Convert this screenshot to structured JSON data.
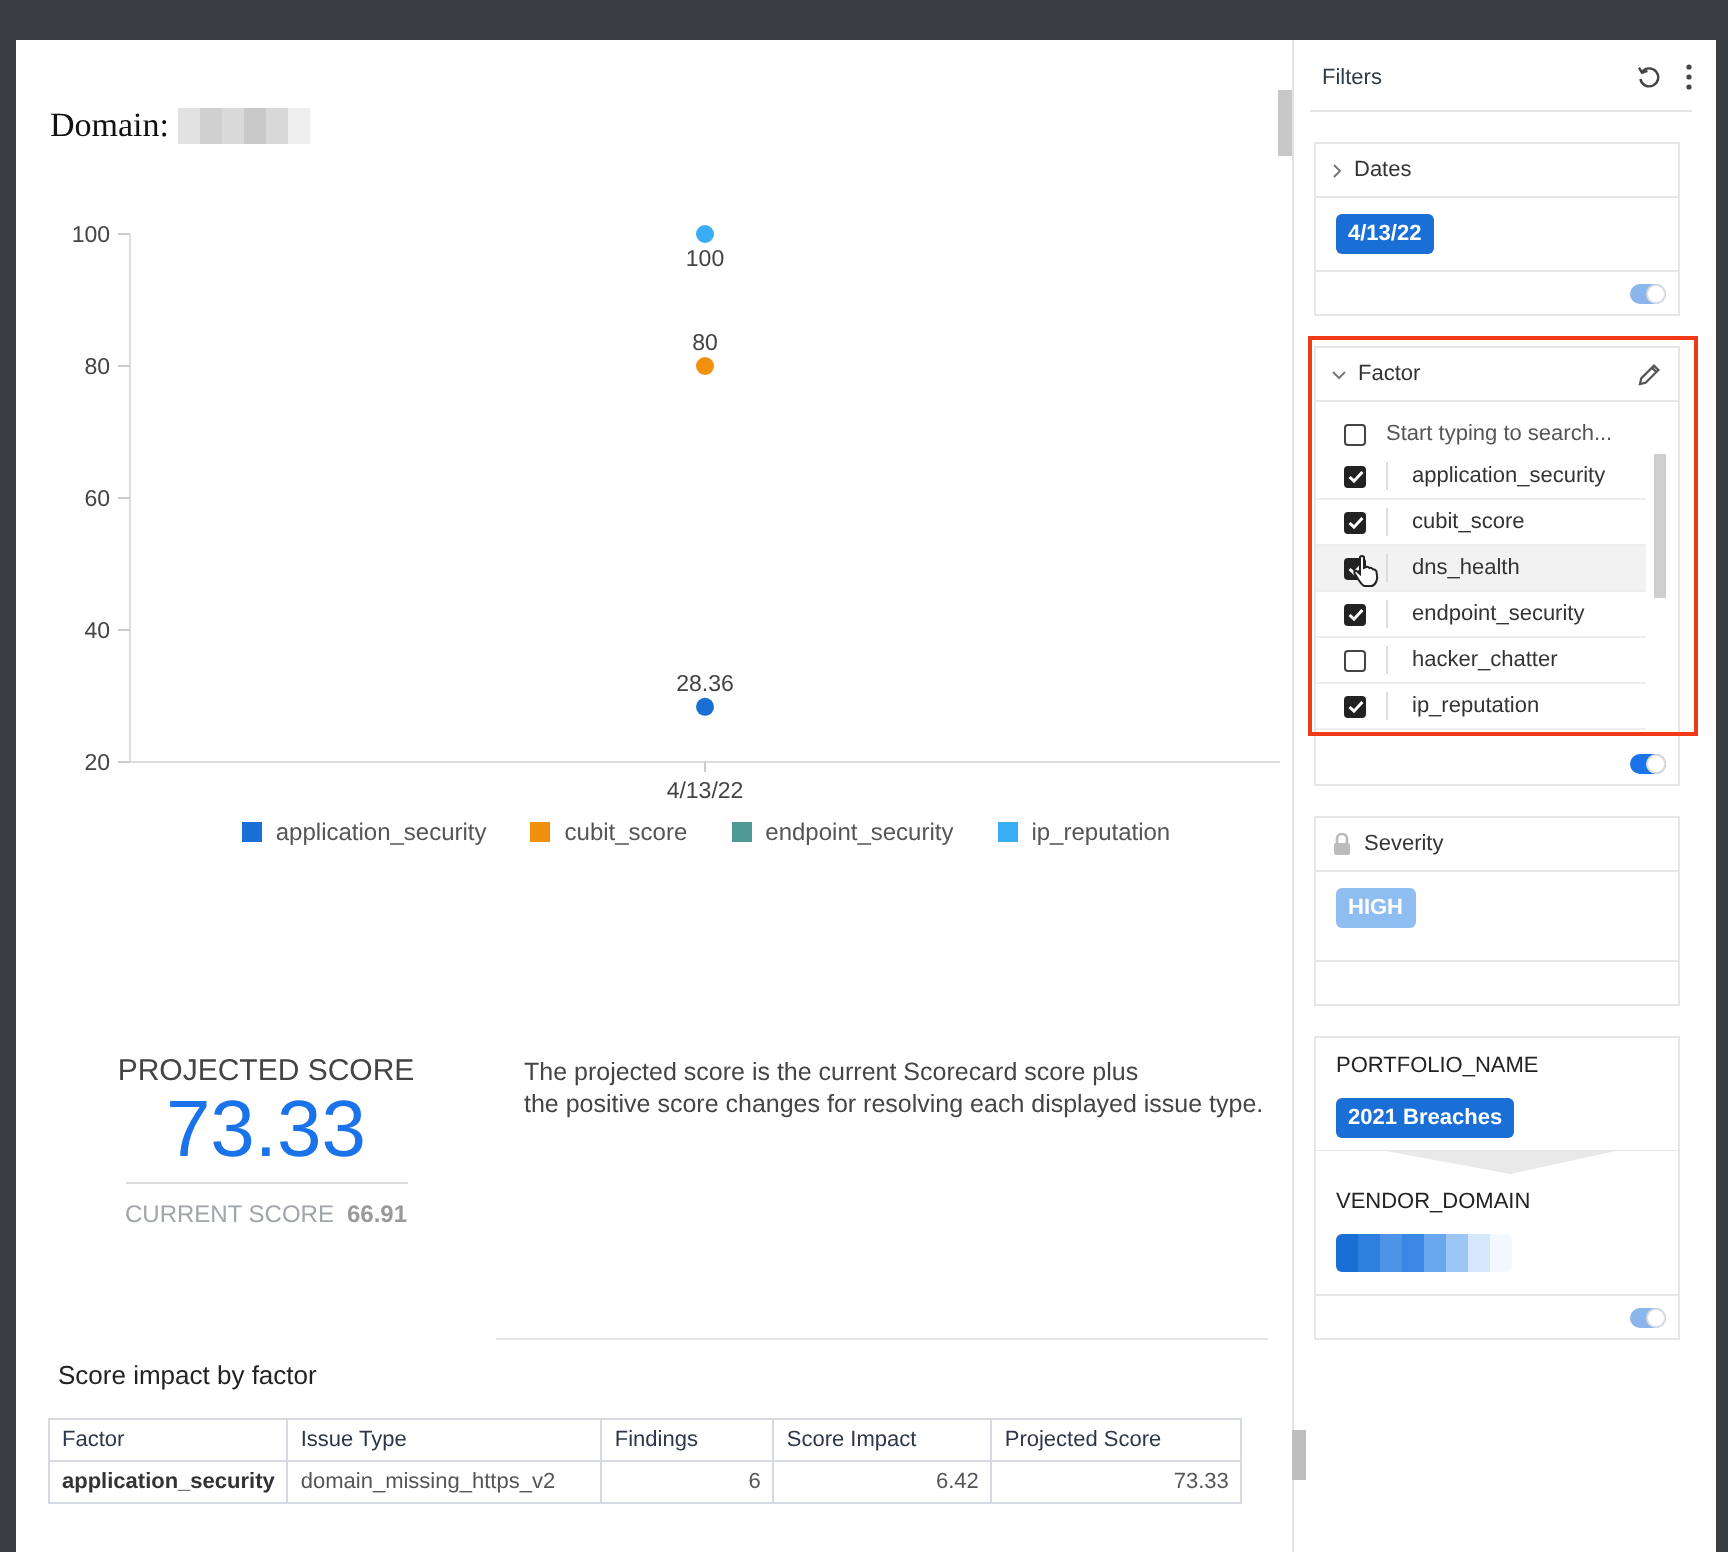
{
  "domain": {
    "label": "Domain:",
    "redacted": true
  },
  "chart": {
    "chart_data": {
      "type": "scatter",
      "categories": [
        "4/13/22"
      ],
      "ylim": [
        20,
        100
      ],
      "yticks": [
        20,
        40,
        60,
        80,
        100
      ],
      "data_labels": true,
      "legend": "bottom",
      "series": [
        {
          "name": "application_security",
          "color": "#1a6fd6",
          "values": [
            28.36
          ]
        },
        {
          "name": "cubit_score",
          "color": "#f0900c",
          "values": [
            80
          ]
        },
        {
          "name": "endpoint_security",
          "color": "#4e9a96",
          "values": [
            null
          ]
        },
        {
          "name": "ip_reputation",
          "color": "#3aaef5",
          "values": [
            100
          ]
        }
      ]
    }
  },
  "score": {
    "title": "PROJECTED SCORE",
    "value": "73.33",
    "current_label": "CURRENT SCORE",
    "current_value": "66.91",
    "description_lines": [
      "The projected score is the current Scorecard score plus",
      "the positive score changes for resolving each displayed issue type."
    ]
  },
  "table": {
    "title": "Score impact by factor",
    "columns": [
      "Factor",
      "Issue Type",
      "Findings",
      "Score Impact",
      "Projected Score"
    ],
    "rows": [
      [
        "application_security",
        "domain_missing_https_v2",
        "6",
        "6.42",
        "73.33"
      ]
    ]
  },
  "filters": {
    "title": "Filters",
    "panels": [
      {
        "kind": "dates",
        "title": "Dates",
        "expanded": false,
        "chips": [
          {
            "label": "4/13/22"
          }
        ],
        "toggle": {
          "on": true,
          "disabled": true
        }
      },
      {
        "kind": "factor",
        "title": "Factor",
        "expanded": true,
        "highlighted": true,
        "search": {
          "placeholder": "Start typing to search...",
          "checked": false
        },
        "items": [
          {
            "label": "application_security",
            "checked": true,
            "hovered": false
          },
          {
            "label": "cubit_score",
            "checked": true,
            "hovered": false
          },
          {
            "label": "dns_health",
            "checked": true,
            "hovered": true
          },
          {
            "label": "endpoint_security",
            "checked": true,
            "hovered": false
          },
          {
            "label": "hacker_chatter",
            "checked": false,
            "hovered": false
          },
          {
            "label": "ip_reputation",
            "checked": true,
            "hovered": false
          }
        ],
        "toggle": {
          "on": true,
          "disabled": false
        }
      },
      {
        "kind": "severity",
        "title": "Severity",
        "locked": true,
        "chips": [
          {
            "label": "HIGH"
          }
        ]
      },
      {
        "kind": "portfolio",
        "sections": [
          {
            "label": "PORTFOLIO_NAME",
            "chips": [
              {
                "label": "2021 Breaches"
              }
            ]
          },
          {
            "label": "VENDOR_DOMAIN",
            "chips": [
              {
                "redacted": true
              }
            ]
          }
        ],
        "toggle": {
          "on": true,
          "disabled": true
        }
      }
    ]
  }
}
